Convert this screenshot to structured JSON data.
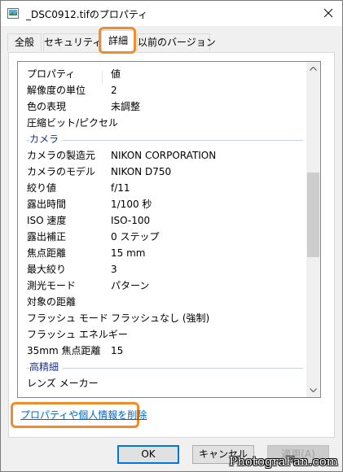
{
  "window": {
    "title": "_DSC0912.tifのプロパティ"
  },
  "tabs": [
    {
      "label": "全般",
      "active": false
    },
    {
      "label": "セキュリティ",
      "active": false
    },
    {
      "label": "詳細",
      "active": true
    },
    {
      "label": "以前のバージョン",
      "active": false
    }
  ],
  "details": {
    "header": {
      "key": "プロパティ",
      "value": "値"
    },
    "rows_top": [
      {
        "key": "解像度の単位",
        "value": "2"
      },
      {
        "key": "色の表現",
        "value": "未調整"
      },
      {
        "key": "圧縮ビット/ピクセル",
        "value": ""
      }
    ],
    "section_camera": "カメラ",
    "rows_camera": [
      {
        "key": "カメラの製造元",
        "value": "NIKON CORPORATION"
      },
      {
        "key": "カメラのモデル",
        "value": "NIKON D750"
      },
      {
        "key": "絞り値",
        "value": "f/11"
      },
      {
        "key": "露出時間",
        "value": "1/100 秒"
      },
      {
        "key": "ISO 速度",
        "value": "ISO-100"
      },
      {
        "key": "露出補正",
        "value": "0 ステップ"
      },
      {
        "key": "焦点距離",
        "value": "15 mm"
      },
      {
        "key": "最大絞り",
        "value": "3"
      },
      {
        "key": "測光モード",
        "value": "パターン"
      },
      {
        "key": "対象の距離",
        "value": ""
      },
      {
        "key": "フラッシュ モード",
        "value": "フラッシュなし (強制)"
      },
      {
        "key": "フラッシュ エネルギー",
        "value": ""
      },
      {
        "key": "35mm 焦点距離",
        "value": "15"
      }
    ],
    "section_advanced": "高精細",
    "rows_advanced": [
      {
        "key": "レンズ メーカー",
        "value": ""
      }
    ]
  },
  "remove_link": "プロパティや個人情報を削除",
  "buttons": {
    "ok": "OK",
    "cancel": "キャンセル",
    "apply": "適用(A)"
  },
  "watermark": "PhotograFan.com",
  "colors": {
    "highlight": "#f08c2a",
    "link": "#0066cc",
    "section": "#1e3287"
  }
}
